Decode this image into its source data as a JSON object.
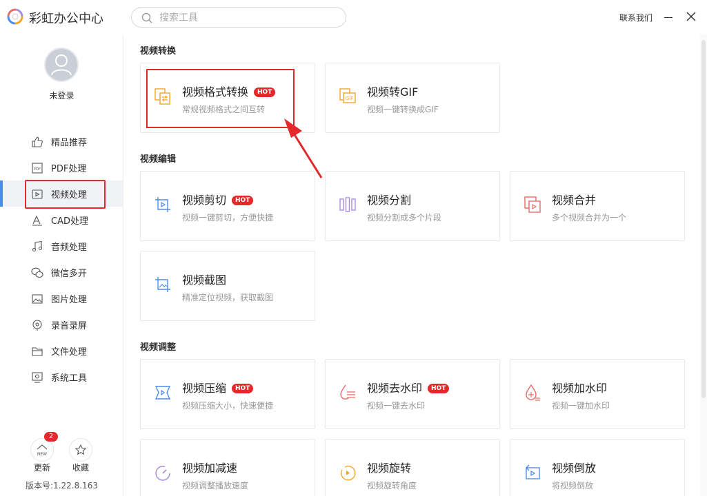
{
  "app": {
    "title": "彩虹办公中心"
  },
  "search": {
    "placeholder": "搜索工具"
  },
  "header": {
    "contact": "联系我们"
  },
  "user": {
    "login_status": "未登录"
  },
  "sidebar": {
    "items": [
      {
        "label": "精品推荐",
        "icon": "thumbs-up-icon"
      },
      {
        "label": "PDF处理",
        "icon": "pdf-icon"
      },
      {
        "label": "视频处理",
        "icon": "video-icon",
        "active": true
      },
      {
        "label": "CAD处理",
        "icon": "cad-icon"
      },
      {
        "label": "音频处理",
        "icon": "music-icon"
      },
      {
        "label": "微信多开",
        "icon": "wechat-icon"
      },
      {
        "label": "图片处理",
        "icon": "image-icon"
      },
      {
        "label": "录音录屏",
        "icon": "record-icon"
      },
      {
        "label": "文件处理",
        "icon": "folder-icon"
      },
      {
        "label": "系统工具",
        "icon": "system-tool-icon"
      }
    ]
  },
  "bottom": {
    "update_label": "更新",
    "update_badge": "2",
    "update_icon_text": "NEW",
    "collect_label": "收藏",
    "version": "版本号:1.22.8.163"
  },
  "sections": [
    {
      "title": "视频转换",
      "cards": [
        {
          "title": "视频格式转换",
          "desc": "常规视频格式之间互转",
          "hot": "HOT"
        },
        {
          "title": "视频转GIF",
          "desc": "视频一键转换成GIF",
          "icon_text": "GIF"
        }
      ]
    },
    {
      "title": "视频编辑",
      "cards": [
        {
          "title": "视频剪切",
          "desc": "视频一键剪切，方便快捷",
          "hot": "HOT"
        },
        {
          "title": "视频分割",
          "desc": "视频分割成多个片段"
        },
        {
          "title": "视频合并",
          "desc": "多个视频合并为一个"
        },
        {
          "title": "视频截图",
          "desc": "精准定位视频，获取截图"
        }
      ]
    },
    {
      "title": "视频调整",
      "cards": [
        {
          "title": "视频压缩",
          "desc": "视频压缩大小，快速便捷",
          "hot": "HOT"
        },
        {
          "title": "视频去水印",
          "desc": "视频一键去水印",
          "hot": "HOT"
        },
        {
          "title": "视频加水印",
          "desc": "视频一键加水印"
        },
        {
          "title": "视频加减速",
          "desc": "视频调整播放速度"
        },
        {
          "title": "视频旋转",
          "desc": "视频旋转角度"
        },
        {
          "title": "视频倒放",
          "desc": "将视频倒放"
        }
      ]
    }
  ],
  "colors": {
    "accent": "#4a8cf0",
    "highlight": "#e3292b",
    "icon_orange": "#f5a623",
    "icon_blue": "#4a8cf0",
    "icon_purple": "#a78bdb",
    "icon_red": "#e86a6a"
  }
}
